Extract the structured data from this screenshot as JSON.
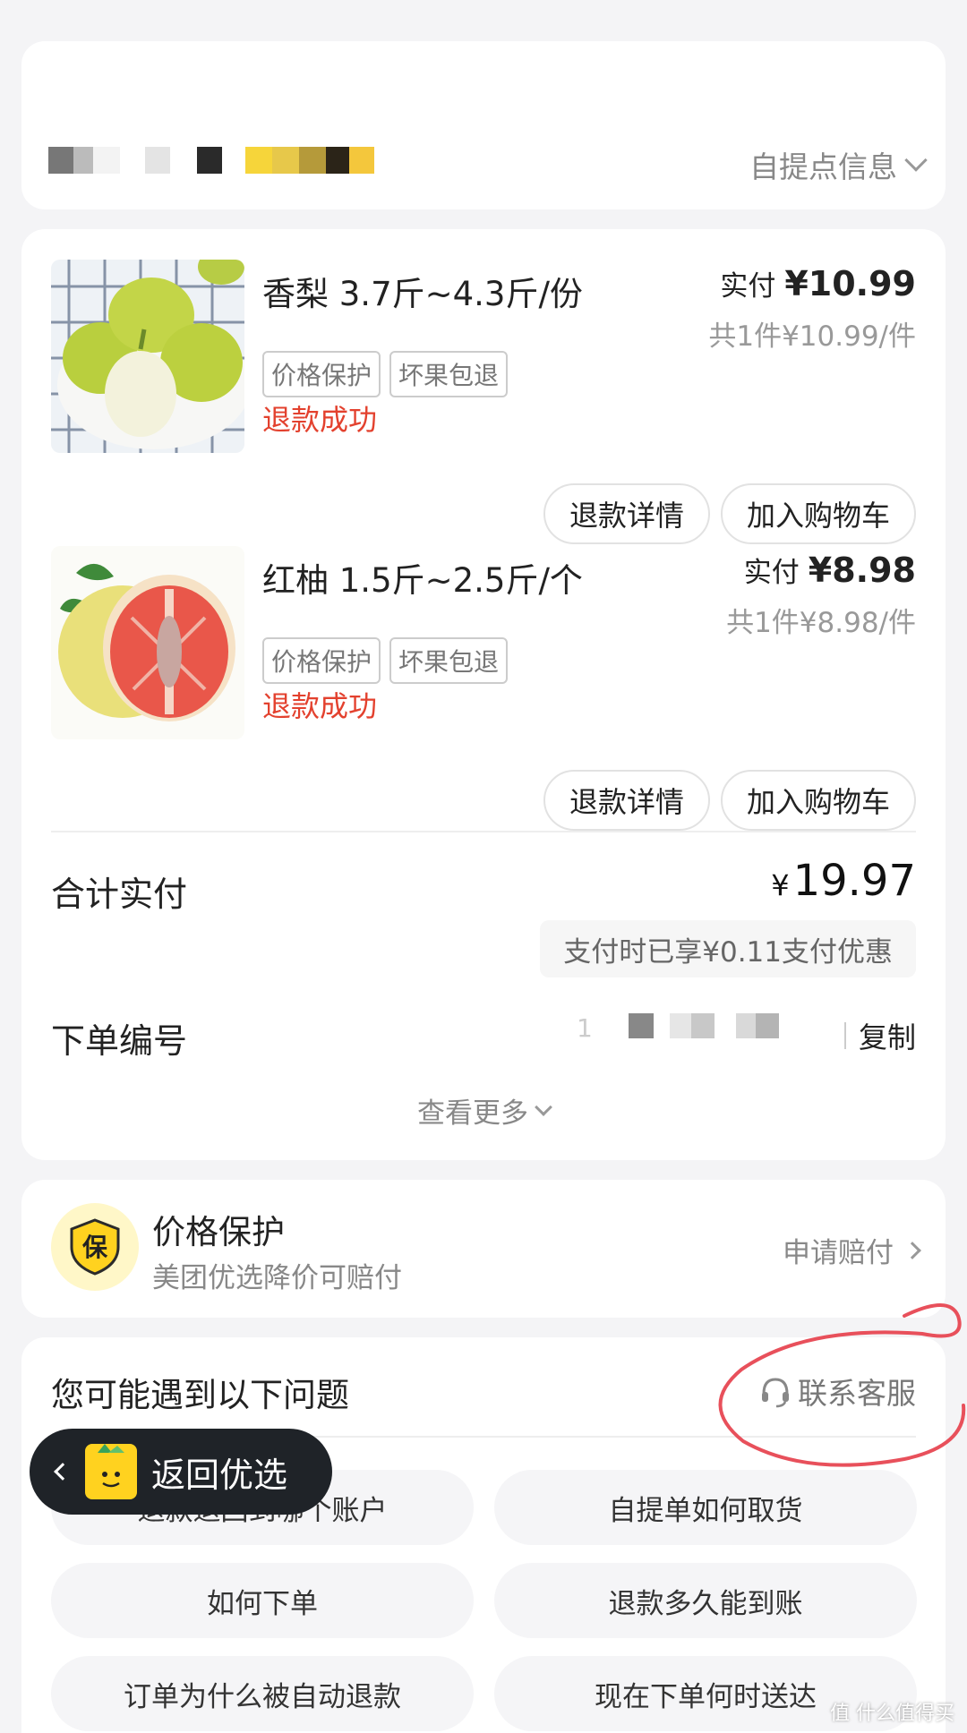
{
  "pickup": {
    "info_label": "自提点信息"
  },
  "items": [
    {
      "title": "香梨 3.7斤~4.3斤/份",
      "paid_label": "实付",
      "paid_amount": "¥10.99",
      "unit_info": "共1件¥10.99/件",
      "tags": [
        "价格保护",
        "坏果包退"
      ],
      "status": "退款成功",
      "refund_btn": "退款详情",
      "cart_btn": "加入购物车"
    },
    {
      "title": "红柚 1.5斤~2.5斤/个",
      "paid_label": "实付",
      "paid_amount": "¥8.98",
      "unit_info": "共1件¥8.98/件",
      "tags": [
        "价格保护",
        "坏果包退"
      ],
      "status": "退款成功",
      "refund_btn": "退款详情",
      "cart_btn": "加入购物车"
    }
  ],
  "summary": {
    "total_label": "合计实付",
    "currency": "¥",
    "total_amount": "19.97",
    "discount_text": "支付时已享¥0.11支付优惠",
    "order_no_label": "下单编号",
    "order_no_visible": "1",
    "copy_label": "复制",
    "more_label": "查看更多"
  },
  "protection": {
    "badge": "保",
    "title": "价格保护",
    "subtitle": "美团优选降价可赔付",
    "claim_label": "申请赔付"
  },
  "faq": {
    "title": "您可能遇到以下问题",
    "contact_label": "联系客服",
    "questions": [
      "退款退回到哪个账户",
      "自提单如何取货",
      "如何下单",
      "退款多久能到账",
      "订单为什么被自动退款",
      "现在下单何时送达"
    ]
  },
  "floating": {
    "back_label": "返回优选"
  },
  "watermark": "值 什么值得买",
  "colors": {
    "refund_red": "#e3412e",
    "brand_yellow": "#ffd21f",
    "annotation_red": "#e8505b"
  }
}
